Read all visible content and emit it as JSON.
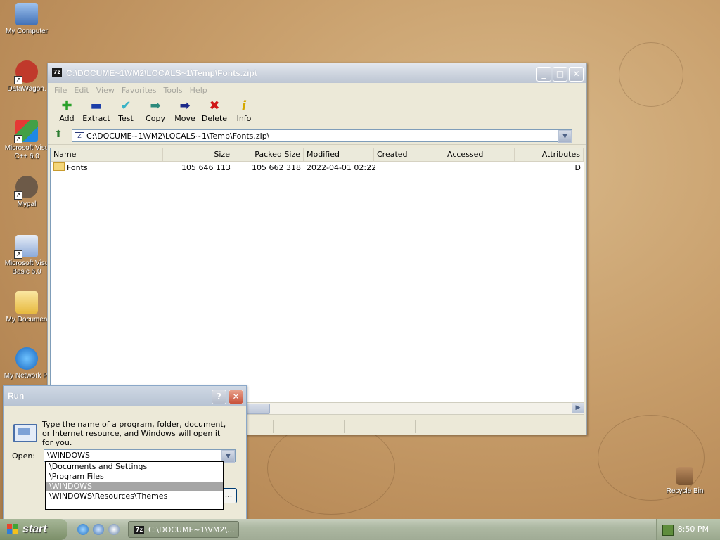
{
  "desktop": {
    "icons": [
      {
        "label": "My Computer"
      },
      {
        "label": "DataWagon."
      },
      {
        "label": "Microsoft Visu C++ 6.0"
      },
      {
        "label": "Mypal"
      },
      {
        "label": "Microsoft Visu Basic 6.0"
      },
      {
        "label": "My Documen"
      },
      {
        "label": "My Network Pl"
      },
      {
        "label": "Recycle Bin"
      }
    ]
  },
  "sevenzip": {
    "title": "C:\\DOCUME~1\\VM2\\LOCALS~1\\Temp\\Fonts.zip\\",
    "app_icon_text": "7z",
    "menu": [
      "File",
      "Edit",
      "View",
      "Favorites",
      "Tools",
      "Help"
    ],
    "toolbar": [
      {
        "label": "Add",
        "icon": "add-icon",
        "color": "#2aa12a",
        "glyph": "✚"
      },
      {
        "label": "Extract",
        "icon": "extract-icon",
        "color": "#1c3ea8",
        "glyph": "▬"
      },
      {
        "label": "Test",
        "icon": "test-icon",
        "color": "#39b3c6",
        "glyph": "✔"
      },
      {
        "label": "Copy",
        "icon": "copy-icon",
        "color": "#2c8a7c",
        "glyph": "➡"
      },
      {
        "label": "Move",
        "icon": "move-icon",
        "color": "#1c2a8a",
        "glyph": "➡"
      },
      {
        "label": "Delete",
        "icon": "delete-icon",
        "color": "#d01818",
        "glyph": "✖"
      },
      {
        "label": "Info",
        "icon": "info-icon",
        "color": "#d4a800",
        "glyph": "i"
      }
    ],
    "address": "C:\\DOCUME~1\\VM2\\LOCALS~1\\Temp\\Fonts.zip\\",
    "columns": [
      "Name",
      "Size",
      "Packed Size",
      "Modified",
      "Created",
      "Accessed",
      "Attributes"
    ],
    "rows": [
      {
        "name": "Fonts",
        "size": "105 646 113",
        "packed": "105 662 318",
        "modified": "2022-04-01 02:22",
        "created": "",
        "accessed": "",
        "attributes": "D"
      }
    ]
  },
  "run": {
    "title": "Run",
    "help": "?",
    "close": "✕",
    "description": "Type the name of a program, folder, document, or Internet resource, and Windows will open it for you.",
    "open_label": "Open:",
    "open_value": "\\WINDOWS",
    "suggestions": [
      "\\Documents and Settings",
      "\\Program Files",
      "\\WINDOWS",
      "\\WINDOWS\\Resources\\Themes"
    ],
    "selected_index": 2,
    "ok_partial": "..."
  },
  "taskbar": {
    "start_label": "start",
    "task_label": "C:\\DOCUME~1\\VM2\\...",
    "task_icon_text": "7z",
    "clock": "8:50 PM"
  }
}
